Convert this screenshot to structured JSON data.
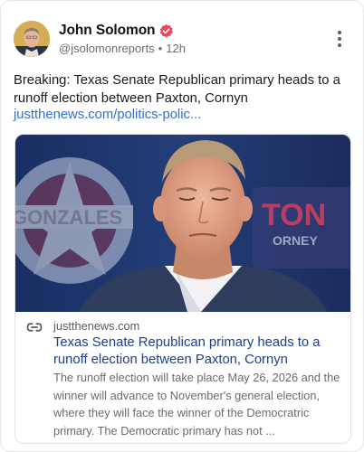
{
  "post": {
    "author_name": "John Solomon",
    "handle": "@jsolomonreports",
    "separator": "•",
    "time": "12h",
    "text": "Breaking: Texas Senate Republican primary heads to a runoff election between Paxton, Cornyn",
    "link_text": "justthenews.com/politics-polic..."
  },
  "link_card": {
    "domain": "justthenews.com",
    "title": "Texas Senate Republican primary heads to a runoff election between Paxton, Cornyn",
    "description": "The runoff election will take place May 26, 2026 and the winner will advance to November's general election, where they will face the winner of the Democratric primary. The Democratic primary has not ...",
    "image_sign_left": "GONZALES",
    "image_sign_right": "TON",
    "image_sign_right_sub": "ORNEY"
  },
  "colors": {
    "link": "#2f6fd0",
    "link_title": "#1c3f8c",
    "verified_badge": "#f0455b",
    "muted_text": "#6b6b6b"
  },
  "icons": {
    "verified": "verified-badge-icon",
    "more": "more-vertical-icon",
    "link": "link-chain-icon"
  }
}
